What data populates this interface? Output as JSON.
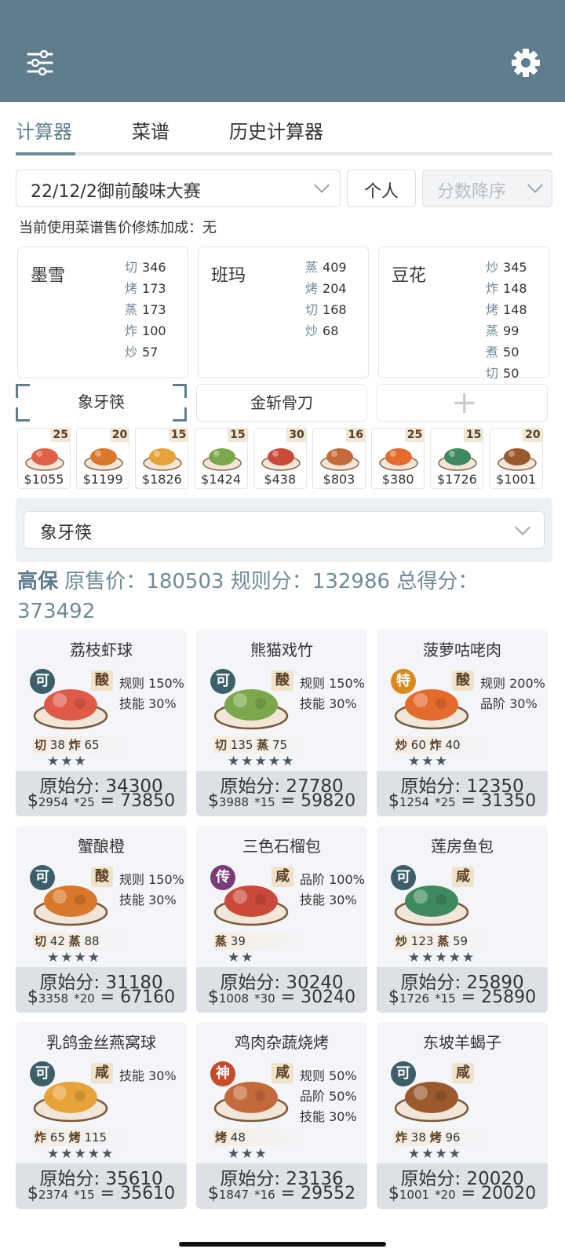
{
  "tabs": [
    "计算器",
    "菜谱",
    "历史计算器"
  ],
  "controls": {
    "contest": "22/12/2御前酸味大赛",
    "mode": "个人",
    "sort": "分数降序"
  },
  "hint": "当前使用菜谱售价修炼加成：无",
  "chefs": [
    {
      "name": "墨雪",
      "skills": [
        [
          "切",
          "346"
        ],
        [
          "烤",
          "173"
        ],
        [
          "蒸",
          "173"
        ],
        [
          "炸",
          "100"
        ],
        [
          "炒",
          "57"
        ]
      ]
    },
    {
      "name": "班玛",
      "skills": [
        [
          "蒸",
          "409"
        ],
        [
          "烤",
          "204"
        ],
        [
          "切",
          "168"
        ],
        [
          "炒",
          "68"
        ]
      ]
    },
    {
      "name": "豆花",
      "skills": [
        [
          "炒",
          "345"
        ],
        [
          "炸",
          "148"
        ],
        [
          "烤",
          "148"
        ],
        [
          "蒸",
          "99"
        ],
        [
          "煮",
          "50"
        ],
        [
          "切",
          "50"
        ]
      ]
    }
  ],
  "equips": [
    "象牙筷",
    "金斩骨刀"
  ],
  "thumbs": [
    {
      "count": "25",
      "price": "$1055",
      "color": "#e0604a"
    },
    {
      "count": "20",
      "price": "$1199",
      "color": "#d9772b"
    },
    {
      "count": "15",
      "price": "$1826",
      "color": "#e8a23a"
    },
    {
      "count": "15",
      "price": "$1424",
      "color": "#7aa84a"
    },
    {
      "count": "30",
      "price": "$438",
      "color": "#c94a3a"
    },
    {
      "count": "16",
      "price": "$803",
      "color": "#c46a3a"
    },
    {
      "count": "25",
      "price": "$380",
      "color": "#e46b2c"
    },
    {
      "count": "15",
      "price": "$1726",
      "color": "#3e8a5e"
    },
    {
      "count": "20",
      "price": "$1001",
      "color": "#9a5a2e"
    }
  ],
  "equip_select": "象牙筷",
  "score": {
    "kw": "高保",
    "text": "原售价：180503 规则分：132986 总得分：373492"
  },
  "cards": [
    {
      "title": "荔枝虾球",
      "rank": "可",
      "rank_color": "#3d5f6a",
      "flavor": "酸",
      "rules": [
        "规则 150%",
        "技能 30%"
      ],
      "req": [
        [
          "切",
          "38"
        ],
        [
          "炸",
          "65"
        ]
      ],
      "stars": "★★★",
      "orig": "原始分: 34300",
      "price": "2954",
      "mult": "*25",
      "total": "= 73850",
      "color": "#e05a48"
    },
    {
      "title": "熊猫戏竹",
      "rank": "可",
      "rank_color": "#3d5f6a",
      "flavor": "酸",
      "rules": [
        "规则 150%",
        "技能 30%"
      ],
      "req": [
        [
          "切",
          "135"
        ],
        [
          "蒸",
          "75"
        ]
      ],
      "stars": "★★★★★",
      "orig": "原始分: 27780",
      "price": "3988",
      "mult": "*15",
      "total": "= 59820",
      "color": "#7aa84a"
    },
    {
      "title": "菠萝咕咾肉",
      "rank": "特",
      "rank_color": "#d98a1c",
      "flavor": "酸",
      "rules": [
        "规则 200%",
        "品阶 30%"
      ],
      "req": [
        [
          "炒",
          "60"
        ],
        [
          "炸",
          "40"
        ]
      ],
      "stars": "★★★",
      "orig": "原始分: 12350",
      "price": "1254",
      "mult": "*25",
      "total": "= 31350",
      "color": "#e46b2c"
    },
    {
      "title": "蟹酿橙",
      "rank": "可",
      "rank_color": "#3d5f6a",
      "flavor": "酸",
      "rules": [
        "规则 150%",
        "技能 30%"
      ],
      "req": [
        [
          "切",
          "42"
        ],
        [
          "蒸",
          "88"
        ]
      ],
      "stars": "★★★★",
      "orig": "原始分: 31180",
      "price": "3358",
      "mult": "*20",
      "total": "= 67160",
      "color": "#d9772b"
    },
    {
      "title": "三色石榴包",
      "rank": "传",
      "rank_color": "#7b3b7a",
      "flavor": "咸",
      "rules": [
        "品阶 100%",
        "技能 30%"
      ],
      "req": [
        [
          "蒸",
          "39"
        ]
      ],
      "stars": "★★",
      "orig": "原始分: 30240",
      "price": "1008",
      "mult": "*30",
      "total": "= 30240",
      "color": "#c94a3a"
    },
    {
      "title": "莲房鱼包",
      "rank": "可",
      "rank_color": "#3d5f6a",
      "flavor": "咸",
      "rules": [],
      "req": [
        [
          "炒",
          "123"
        ],
        [
          "蒸",
          "59"
        ]
      ],
      "stars": "★★★★★",
      "orig": "原始分: 25890",
      "price": "1726",
      "mult": "*15",
      "total": "= 25890",
      "color": "#3e8a5e"
    },
    {
      "title": "乳鸽金丝燕窝球",
      "rank": "可",
      "rank_color": "#3d5f6a",
      "flavor": "咸",
      "rules": [
        "技能 30%"
      ],
      "req": [
        [
          "炸",
          "65"
        ],
        [
          "烤",
          "115"
        ]
      ],
      "stars": "★★★★★",
      "orig": "原始分: 35610",
      "price": "2374",
      "mult": "*15",
      "total": "= 35610",
      "color": "#e8a23a"
    },
    {
      "title": "鸡肉杂蔬烧烤",
      "rank": "神",
      "rank_color": "#c84a2a",
      "flavor": "咸",
      "rules": [
        "规则 50%",
        "品阶 50%",
        "技能 30%"
      ],
      "req": [
        [
          "烤",
          "48"
        ]
      ],
      "stars": "★★★",
      "orig": "原始分: 23136",
      "price": "1847",
      "mult": "*16",
      "total": "= 29552",
      "color": "#c46a3a"
    },
    {
      "title": "东坡羊蝎子",
      "rank": "可",
      "rank_color": "#3d5f6a",
      "flavor": "咸",
      "rules": [],
      "req": [
        [
          "炸",
          "38"
        ],
        [
          "烤",
          "96"
        ]
      ],
      "stars": "★★★★",
      "orig": "原始分: 20020",
      "price": "1001",
      "mult": "*20",
      "total": "= 20020",
      "color": "#9a5a2e"
    }
  ]
}
